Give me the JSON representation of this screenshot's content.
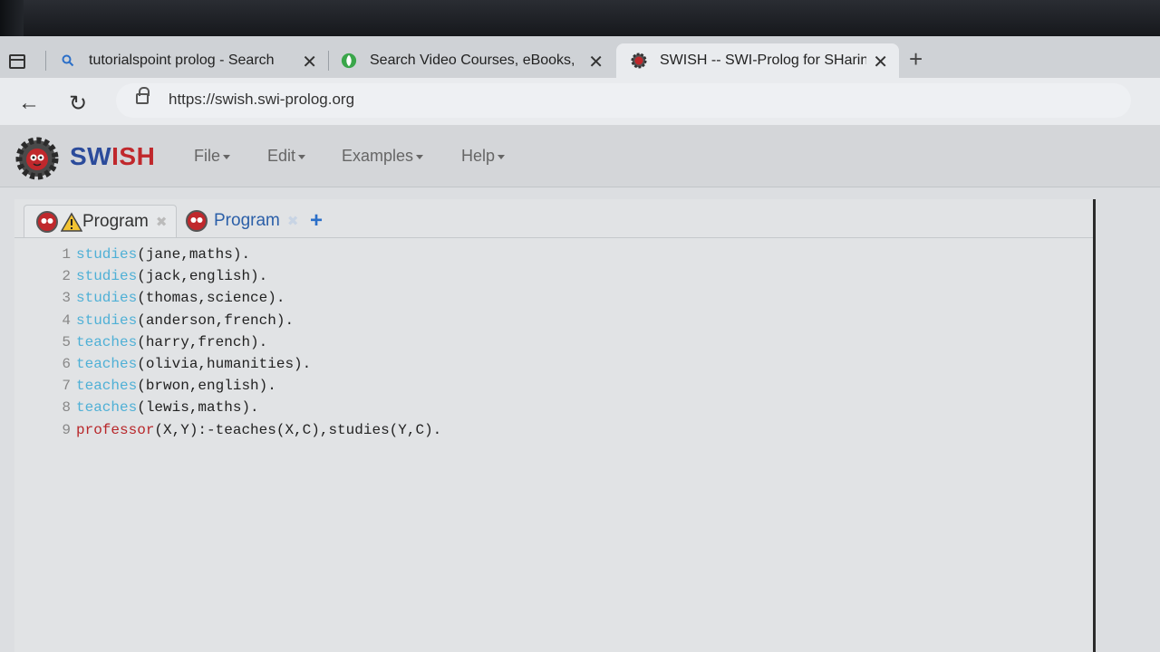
{
  "browser": {
    "tabs": [
      {
        "title": "tutorialspoint prolog - Search",
        "icon": "search-icon"
      },
      {
        "title": "Search Video Courses, eBooks, C",
        "icon": "green-favicon-icon"
      },
      {
        "title": "SWISH -- SWI-Prolog for SHaring",
        "icon": "swish-gear-icon"
      }
    ],
    "close_glyph": "✕",
    "new_tab_glyph": "+",
    "back_glyph": "←",
    "reload_glyph": "↻",
    "url": "https://swish.swi-prolog.org"
  },
  "app": {
    "brand_sw": "SW",
    "brand_ish": "ISH",
    "menu": {
      "file": "File",
      "edit": "Edit",
      "examples": "Examples",
      "help": "Help"
    },
    "editor_tabs": [
      {
        "label": "Program",
        "warning": true
      },
      {
        "label": "Program",
        "warning": false
      }
    ],
    "tab_close_glyph": "✖",
    "add_tab_glyph": "+",
    "code_lines": [
      {
        "num": "1",
        "pred": "studies",
        "rest": "(jane,maths)."
      },
      {
        "num": "2",
        "pred": "studies",
        "rest": "(jack,english)."
      },
      {
        "num": "3",
        "pred": "studies",
        "rest": "(thomas,science)."
      },
      {
        "num": "4",
        "pred": "studies",
        "rest": "(anderson,french)."
      },
      {
        "num": "5",
        "pred": "teaches",
        "rest": "(harry,french)."
      },
      {
        "num": "6",
        "pred": "teaches",
        "rest": "(olivia,humanities)."
      },
      {
        "num": "7",
        "pred": "teaches",
        "rest": "(brwon,english)."
      },
      {
        "num": "8",
        "pred": "teaches",
        "rest": "(lewis,maths)."
      }
    ],
    "rule_line": {
      "num": "9",
      "head": "professor",
      "body": "(X,Y):-teaches(X,C),studies(Y,C)."
    }
  },
  "colors": {
    "fact_predicate": "#4fb0d6",
    "rule_head": "#b8272a",
    "brand_blue": "#2b4b9b",
    "brand_red": "#c0282c",
    "add_tab": "#2b6fc8"
  }
}
